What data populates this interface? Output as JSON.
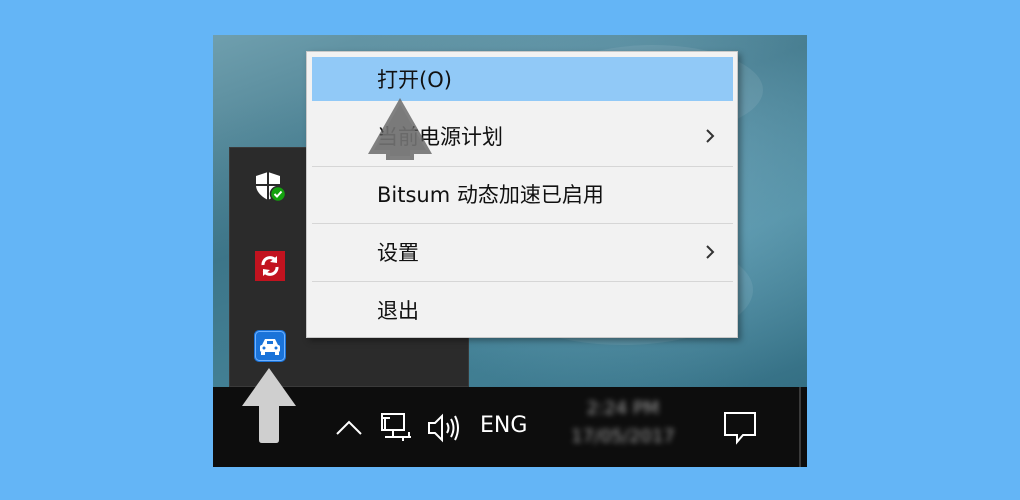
{
  "context_menu": {
    "items": [
      {
        "label": "打开(O)",
        "submenu": false
      },
      {
        "label": "当前电源计划",
        "submenu": true
      },
      {
        "label": "Bitsum 动态加速已启用",
        "submenu": false
      },
      {
        "label": "设置",
        "submenu": true
      },
      {
        "label": "退出",
        "submenu": false
      }
    ]
  },
  "tray": {
    "icons": [
      "windows-security-icon",
      "sync-app-icon",
      "car-app-icon"
    ]
  },
  "taskbar": {
    "language": "ENG",
    "clock_time": "2:24 PM",
    "clock_date": "17/05/2017",
    "icons": [
      "chevron-up-icon",
      "network-icon",
      "speaker-icon",
      "action-center-icon"
    ]
  },
  "colors": {
    "page_background": "#64b5f6",
    "menu_highlight": "#91c9f7",
    "taskbar": "#0d0d0d"
  }
}
